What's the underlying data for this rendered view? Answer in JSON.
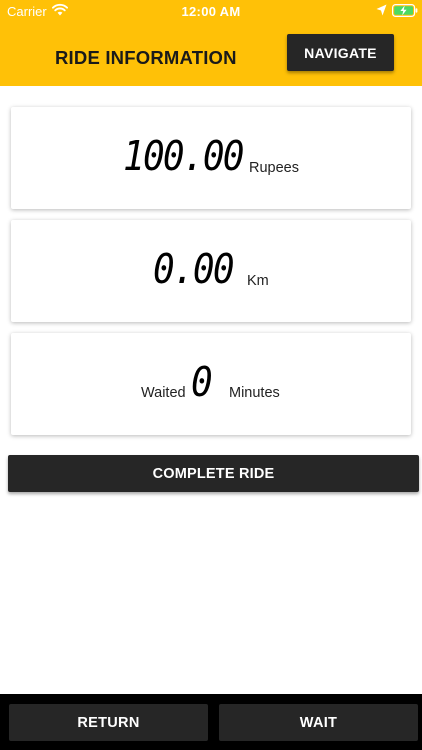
{
  "status_bar": {
    "carrier": "Carrier",
    "time": "12:00 AM",
    "icons": [
      "wifi-icon",
      "location-arrow-icon",
      "battery-charging-icon"
    ]
  },
  "header": {
    "title": "RIDE INFORMATION",
    "navigate_label": "NAVIGATE"
  },
  "fare": {
    "value": "100.00",
    "unit": "Rupees"
  },
  "distance": {
    "value": "0.00",
    "unit": "Km"
  },
  "wait": {
    "label": "Waited",
    "value": "0",
    "unit": "Minutes"
  },
  "actions": {
    "complete_label": "COMPLETE RIDE",
    "return_label": "RETURN",
    "wait_label": "WAIT"
  },
  "colors": {
    "header_background": "#FFC107",
    "button_background": "#262626",
    "button_text": "#FFFFFF",
    "bottom_bar": "#000000",
    "battery_fill": "#4CD964"
  }
}
